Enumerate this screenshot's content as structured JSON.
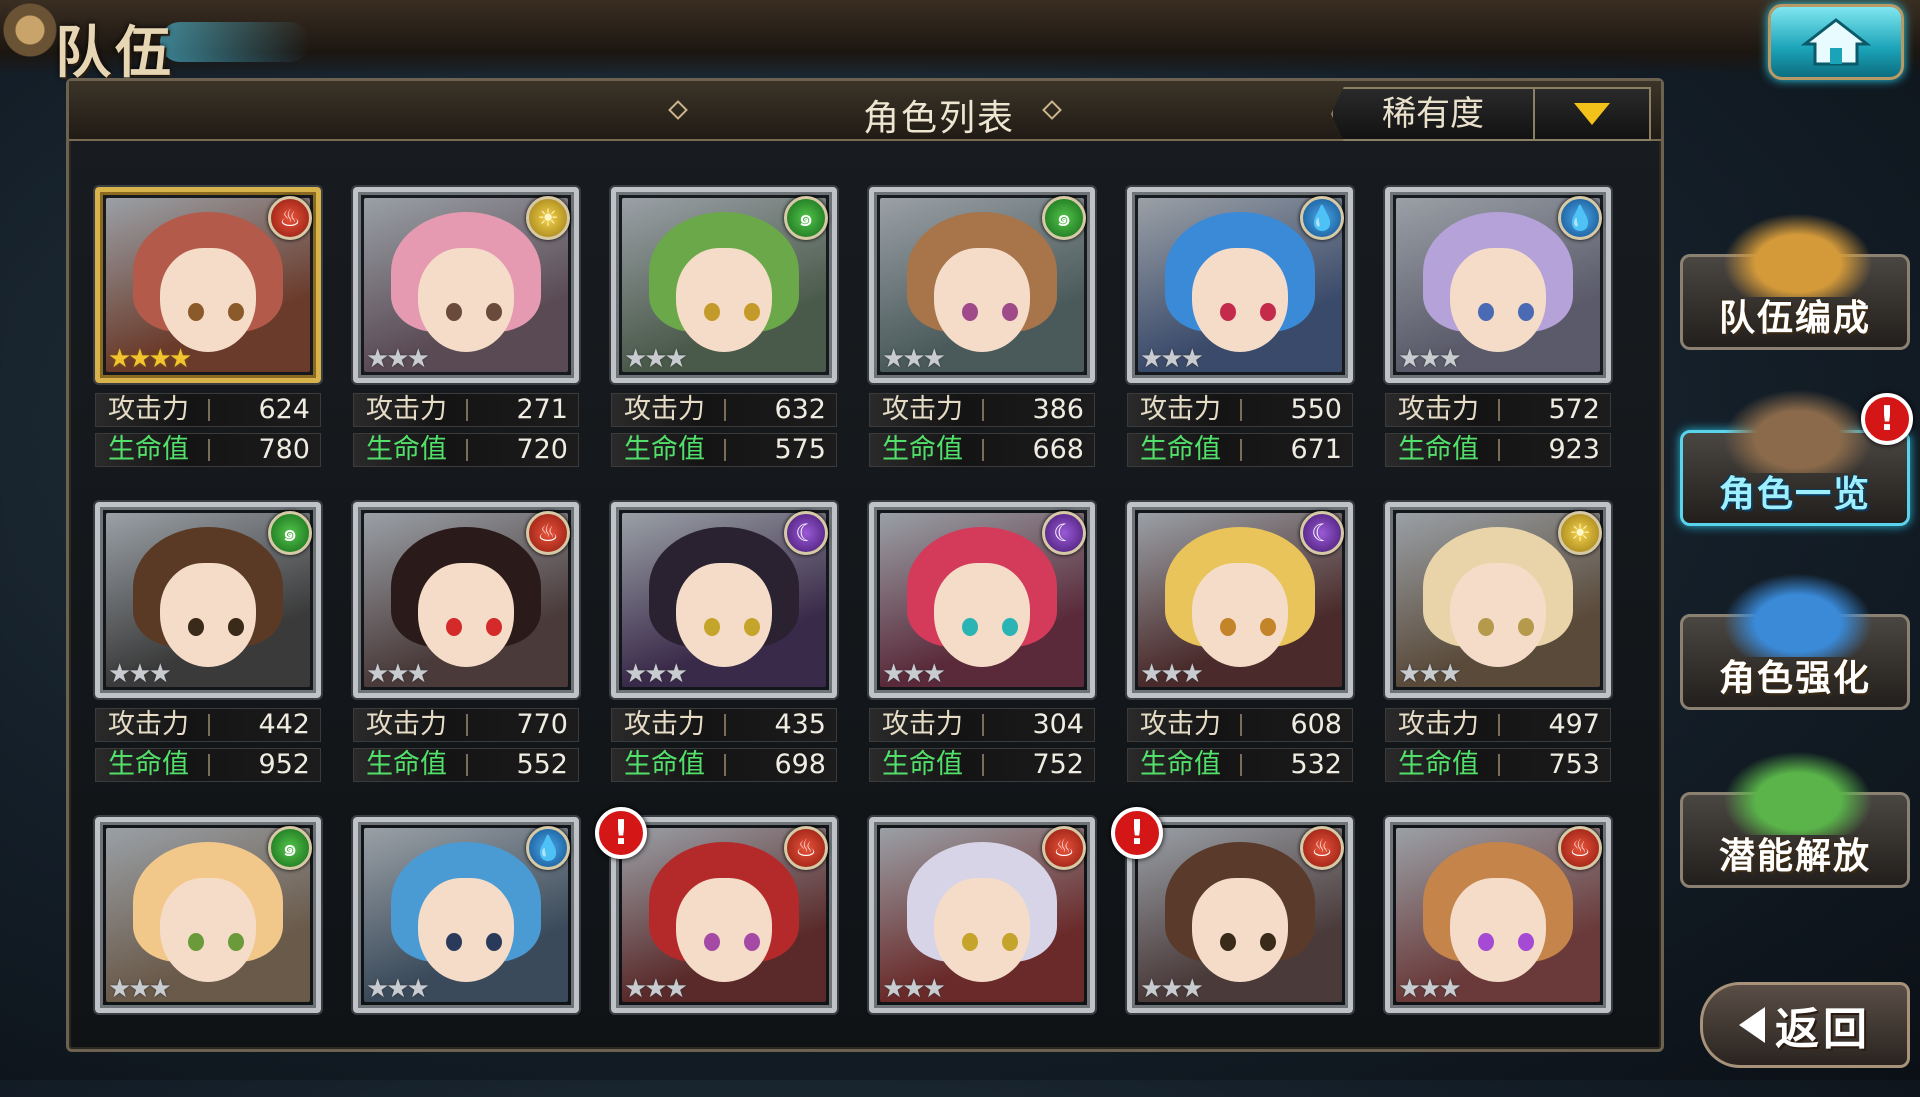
{
  "header": {
    "title": "队伍"
  },
  "panel": {
    "title": "角色列表",
    "sort_label": "稀有度"
  },
  "labels": {
    "attack": "攻击力",
    "hp": "生命值"
  },
  "cards": [
    {
      "element": "fire",
      "stars": "★★★★",
      "rarity": "gold",
      "attack": "624",
      "hp": "780",
      "alert": false,
      "hair": "#b35a4a",
      "eye": "#8a5a2a",
      "bg": "#6a3a2a"
    },
    {
      "element": "light",
      "stars": "★★★",
      "rarity": "silver",
      "attack": "271",
      "hp": "720",
      "alert": false,
      "hair": "#e69ab2",
      "eye": "#6a4a3a",
      "bg": "#5a4a54"
    },
    {
      "element": "wind",
      "stars": "★★★",
      "rarity": "silver",
      "attack": "632",
      "hp": "575",
      "alert": false,
      "hair": "#6aa84a",
      "eye": "#c49a2a",
      "bg": "#4a5a4a"
    },
    {
      "element": "wind",
      "stars": "★★★",
      "rarity": "silver",
      "attack": "386",
      "hp": "668",
      "alert": false,
      "hair": "#a8744a",
      "eye": "#a04a8a",
      "bg": "#4a5a5a"
    },
    {
      "element": "water",
      "stars": "★★★",
      "rarity": "silver",
      "attack": "550",
      "hp": "671",
      "alert": false,
      "hair": "#3a8ad8",
      "eye": "#c42a4a",
      "bg": "#3a4a6a"
    },
    {
      "element": "water",
      "stars": "★★★",
      "rarity": "silver",
      "attack": "572",
      "hp": "923",
      "alert": false,
      "hair": "#b4a2d8",
      "eye": "#4a6ab4",
      "bg": "#5a5a6a"
    },
    {
      "element": "wind",
      "stars": "★★★",
      "rarity": "silver",
      "attack": "442",
      "hp": "952",
      "alert": false,
      "hair": "#5a3a24",
      "eye": "#3a2a1a",
      "bg": "#3a3a3a"
    },
    {
      "element": "fire",
      "stars": "★★★",
      "rarity": "silver",
      "attack": "770",
      "hp": "552",
      "alert": false,
      "hair": "#2a1a1a",
      "eye": "#d42a2a",
      "bg": "#4a3a3a"
    },
    {
      "element": "dark",
      "stars": "★★★",
      "rarity": "silver",
      "attack": "435",
      "hp": "698",
      "alert": false,
      "hair": "#2a2230",
      "eye": "#c4a42a",
      "bg": "#3a2a4a"
    },
    {
      "element": "dark",
      "stars": "★★★",
      "rarity": "silver",
      "attack": "304",
      "hp": "752",
      "alert": false,
      "hair": "#d43a5a",
      "eye": "#2ab4b4",
      "bg": "#5a2a3a"
    },
    {
      "element": "dark",
      "stars": "★★★",
      "rarity": "silver",
      "attack": "608",
      "hp": "532",
      "alert": false,
      "hair": "#e8c45a",
      "eye": "#c4842a",
      "bg": "#4a2a2a"
    },
    {
      "element": "light",
      "stars": "★★★",
      "rarity": "silver",
      "attack": "497",
      "hp": "753",
      "alert": false,
      "hair": "#e8d4a8",
      "eye": "#b49a4a",
      "bg": "#5a4a3a"
    },
    {
      "element": "wind",
      "stars": "★★★",
      "rarity": "silver",
      "attack": "",
      "hp": "",
      "alert": false,
      "hair": "#f2c88a",
      "eye": "#6a9a3a",
      "bg": "#6a5a4a"
    },
    {
      "element": "water",
      "stars": "★★★",
      "rarity": "silver",
      "attack": "",
      "hp": "",
      "alert": false,
      "hair": "#4a9ad4",
      "eye": "#2a3a5a",
      "bg": "#3a4a5a"
    },
    {
      "element": "fire",
      "stars": "★★★",
      "rarity": "silver",
      "attack": "",
      "hp": "",
      "alert": true,
      "hair": "#b42a2a",
      "eye": "#a44aa4",
      "bg": "#5a2a2a"
    },
    {
      "element": "fire",
      "stars": "★★★",
      "rarity": "silver",
      "attack": "",
      "hp": "",
      "alert": false,
      "hair": "#d8d4e8",
      "eye": "#c4a42a",
      "bg": "#6a2a2a"
    },
    {
      "element": "fire",
      "stars": "★★★",
      "rarity": "silver",
      "attack": "",
      "hp": "",
      "alert": true,
      "hair": "#5a3a2a",
      "eye": "#3a2a1a",
      "bg": "#4a3a3a"
    },
    {
      "element": "fire",
      "stars": "★★★",
      "rarity": "silver",
      "attack": "",
      "hp": "",
      "alert": false,
      "hair": "#c4844a",
      "eye": "#a44ad4",
      "bg": "#6a3a3a"
    }
  ],
  "menu": [
    {
      "label": "队伍编成",
      "active": false,
      "alert": false
    },
    {
      "label": "角色一览",
      "active": true,
      "alert": true
    },
    {
      "label": "角色强化",
      "active": false,
      "alert": false
    },
    {
      "label": "潜能解放",
      "active": false,
      "alert": false
    }
  ],
  "back_label": "返回",
  "alert_glyph": "!",
  "element_glyphs": {
    "fire": "♨",
    "light": "☀",
    "wind": "๑",
    "water": "💧",
    "dark": "☾"
  },
  "colors": {
    "hp_label": "#52e06a",
    "accent": "#f2c21b",
    "alert": "#d41616"
  }
}
